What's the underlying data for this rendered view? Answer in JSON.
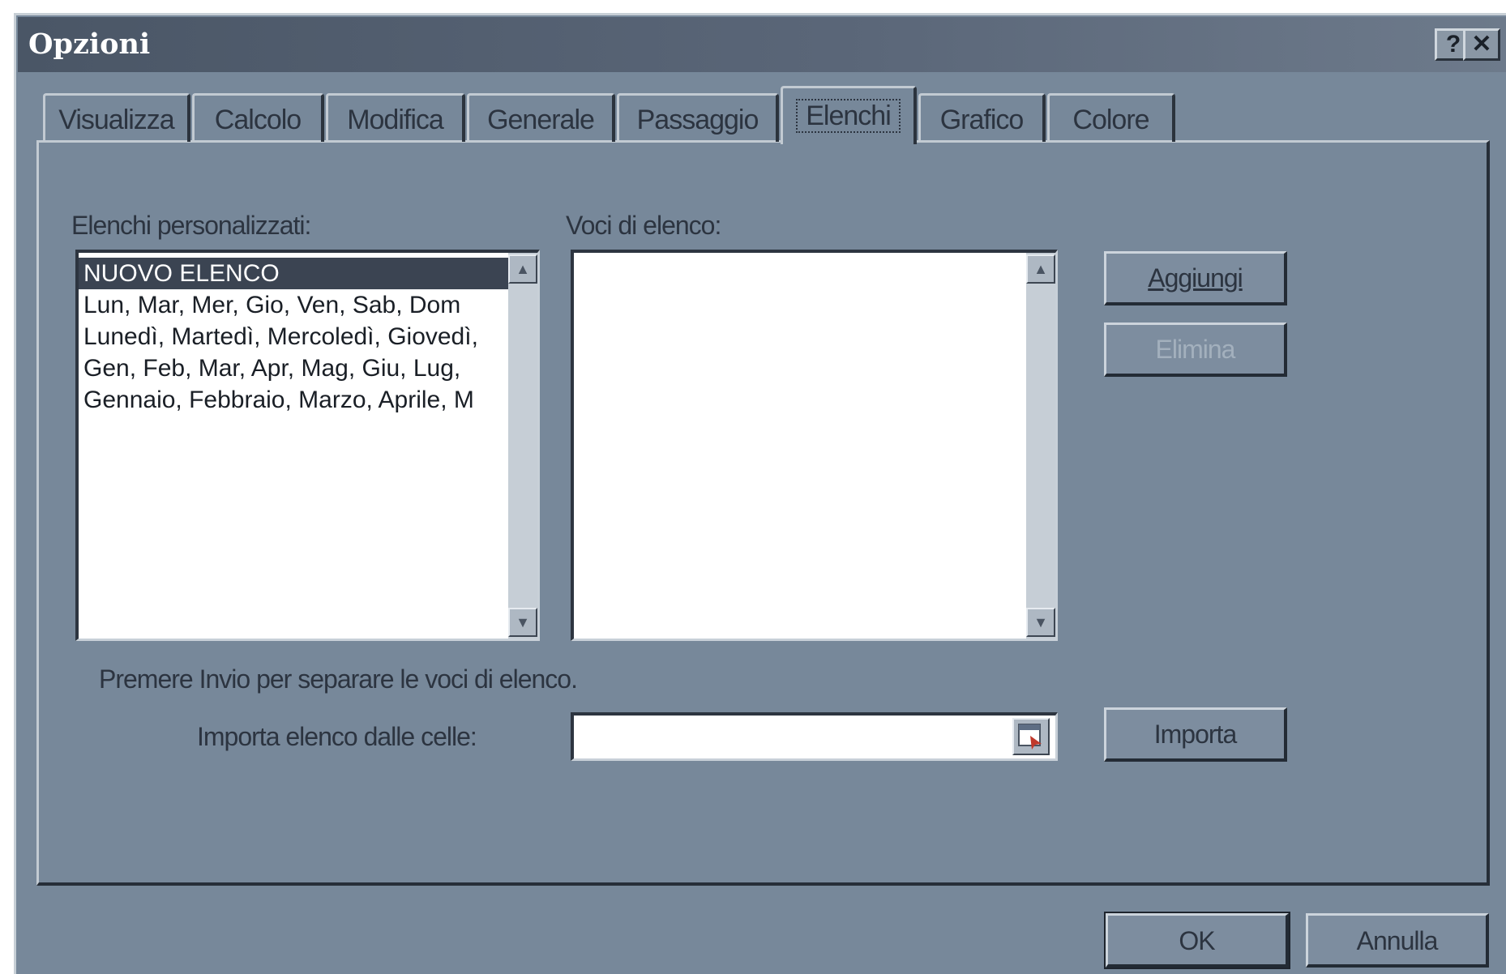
{
  "window": {
    "title": "Opzioni",
    "help_label": "?",
    "close_label": "✕"
  },
  "tabs": [
    {
      "label": "Visualizza",
      "active": false
    },
    {
      "label": "Calcolo",
      "active": false
    },
    {
      "label": "Modifica",
      "active": false
    },
    {
      "label": "Generale",
      "active": false
    },
    {
      "label": "Passaggio",
      "active": false
    },
    {
      "label": "Elenchi",
      "active": true
    },
    {
      "label": "Grafico",
      "active": false
    },
    {
      "label": "Colore",
      "active": false
    }
  ],
  "custom_lists": {
    "label": "Elenchi personalizzati:",
    "items": [
      "NUOVO ELENCO",
      "Lun, Mar, Mer, Gio, Ven, Sab, Dom",
      "Lunedì, Martedì, Mercoledì, Giovedì,",
      "Gen, Feb, Mar, Apr, Mag, Giu, Lug,",
      "Gennaio, Febbraio, Marzo, Aprile, M"
    ],
    "selected_index": 0
  },
  "list_entries": {
    "label": "Voci di elenco:"
  },
  "buttons": {
    "add": "Aggiungi",
    "delete": "Elimina",
    "import": "Importa",
    "ok": "OK",
    "cancel": "Annulla"
  },
  "hint_text": "Premere Invio per separare le voci di elenco.",
  "import_field": {
    "label": "Importa elenco dalle celle:",
    "value": ""
  },
  "icons": {
    "scroll_up": "scroll-up-icon",
    "scroll_down": "scroll-down-icon",
    "range_picker": "collapse-dialog-icon"
  },
  "colors": {
    "dialog_bg": "#77889a",
    "titlebar": "#4a5666",
    "selection": "#3b4452"
  }
}
